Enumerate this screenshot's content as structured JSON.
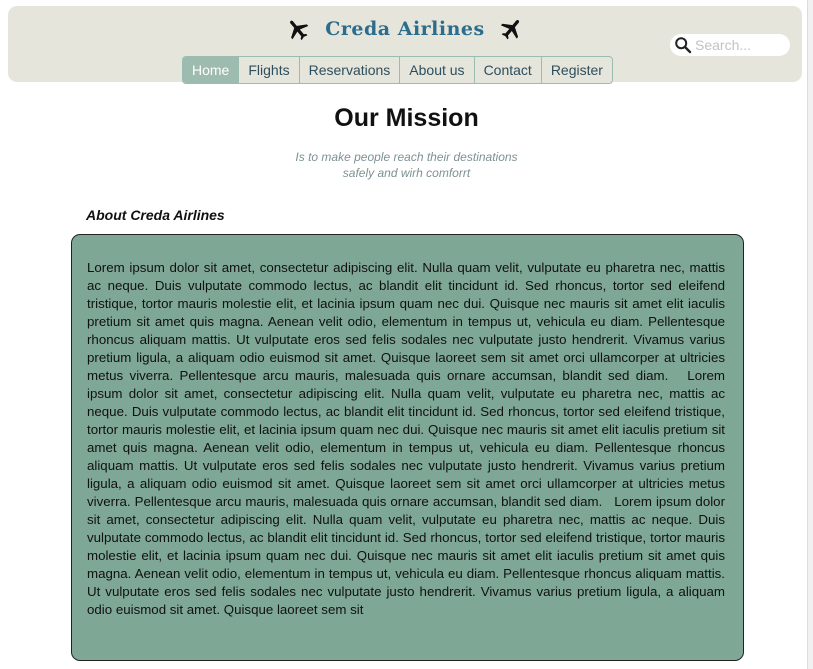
{
  "header": {
    "brand_title": "Creda Airlines",
    "left_icon": "airplane-icon",
    "right_icon": "airplane-icon",
    "search": {
      "placeholder": "Search...",
      "value": "",
      "icon": "search-icon"
    },
    "nav": [
      {
        "label": "Home",
        "active": true
      },
      {
        "label": "Flights",
        "active": false
      },
      {
        "label": "Reservations",
        "active": false
      },
      {
        "label": "About us",
        "active": false
      },
      {
        "label": "Contact",
        "active": false
      },
      {
        "label": "Register",
        "active": false
      }
    ]
  },
  "main": {
    "title": "Our Mission",
    "tagline_line1": "Is to make people reach their destinations",
    "tagline_line2": "safely and wirh comforrt",
    "section_heading": "About Creda Airlines",
    "body_text": "Lorem ipsum dolor sit amet, consectetur adipiscing elit. Nulla quam velit, vulputate eu pharetra nec, mattis ac neque. Duis vulputate commodo lectus, ac blandit elit tincidunt id. Sed rhoncus, tortor sed eleifend tristique, tortor mauris molestie elit, et lacinia ipsum quam nec dui. Quisque nec mauris sit amet elit iaculis pretium sit amet quis magna. Aenean velit odio, elementum in tempus ut, vehicula eu diam. Pellentesque rhoncus aliquam mattis. Ut vulputate eros sed felis sodales nec vulputate justo hendrerit. Vivamus varius pretium ligula, a aliquam odio euismod sit amet. Quisque laoreet sem sit amet orci ullamcorper at ultricies metus viverra. Pellentesque arcu mauris, malesuada quis ornare accumsan, blandit sed diam.   Lorem ipsum dolor sit amet, consectetur adipiscing elit. Nulla quam velit, vulputate eu pharetra nec, mattis ac neque. Duis vulputate commodo lectus, ac blandit elit tincidunt id. Sed rhoncus, tortor sed eleifend tristique, tortor mauris molestie elit, et lacinia ipsum quam nec dui. Quisque nec mauris sit amet elit iaculis pretium sit amet quis magna. Aenean velit odio, elementum in tempus ut, vehicula eu diam. Pellentesque rhoncus aliquam mattis. Ut vulputate eros sed felis sodales nec vulputate justo hendrerit. Vivamus varius pretium ligula, a aliquam odio euismod sit amet. Quisque laoreet sem sit amet orci ullamcorper at ultricies metus viverra. Pellentesque arcu mauris, malesuada quis ornare accumsan, blandit sed diam.   Lorem ipsum dolor sit amet, consectetur adipiscing elit. Nulla quam velit, vulputate eu pharetra nec, mattis ac neque. Duis vulputate commodo lectus, ac blandit elit tincidunt id. Sed rhoncus, tortor sed eleifend tristique, tortor mauris molestie elit, et lacinia ipsum quam nec dui. Quisque nec mauris sit amet elit iaculis pretium sit amet quis magna. Aenean velit odio, elementum in tempus ut, vehicula eu diam. Pellentesque rhoncus aliquam mattis. Ut vulputate eros sed felis sodales nec vulputate justo hendrerit. Vivamus varius pretium ligula, a aliquam odio euismod sit amet. Quisque laoreet sem sit"
  },
  "colors": {
    "header_bg": "#e6e5dc",
    "brand": "#2a6d8c",
    "nav_active_bg": "#9dbbae",
    "content_bg": "#7ea795",
    "tagline": "#7d9194"
  }
}
